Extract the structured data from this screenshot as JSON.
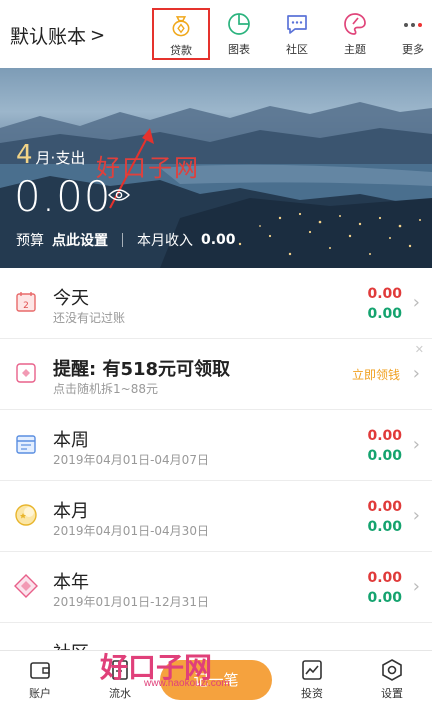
{
  "header": {
    "book_title": "默认账本",
    "chevron": ">",
    "actions": [
      {
        "label": "贷款",
        "icon": "loan-bag-icon"
      },
      {
        "label": "图表",
        "icon": "pie-chart-icon"
      },
      {
        "label": "社区",
        "icon": "chat-bubble-icon"
      },
      {
        "label": "主题",
        "icon": "palette-icon"
      },
      {
        "label": "更多",
        "icon": "more-dots-icon"
      }
    ]
  },
  "banner": {
    "month_num": "4",
    "month_suffix": "月·支出",
    "amount": "0.00",
    "budget_label": "预算",
    "budget_link": "点此设置",
    "income_label": "本月收入",
    "income_value": "0.00",
    "watermark": "好口子网"
  },
  "list": [
    {
      "title": "今天",
      "sub": "还没有记过账",
      "out": "0.00",
      "in": "0.00",
      "icon": "calendar-today-icon"
    },
    {
      "title": "提醒: 有518元可领取",
      "sub": "点击随机拆1~88元",
      "cta": "立即领钱",
      "icon": "red-envelope-icon"
    },
    {
      "title": "本周",
      "sub": "2019年04月01日-04月07日",
      "out": "0.00",
      "in": "0.00",
      "icon": "calendar-week-icon"
    },
    {
      "title": "本月",
      "sub": "2019年04月01日-04月30日",
      "out": "0.00",
      "in": "0.00",
      "icon": "moon-icon"
    },
    {
      "title": "本年",
      "sub": "2019年01月01日-12月31日",
      "out": "0.00",
      "in": "0.00",
      "icon": "diamond-icon"
    },
    {
      "title": "社区",
      "icon": "community-icon"
    }
  ],
  "bottom_nav": {
    "items": [
      {
        "label": "账户",
        "icon": "wallet-icon"
      },
      {
        "label": "流水",
        "icon": "receipt-icon"
      },
      {
        "label": "投资",
        "icon": "trend-chart-icon"
      },
      {
        "label": "设置",
        "icon": "settings-hex-icon"
      }
    ],
    "add_label": "记一笔",
    "watermark_big": "好口子网",
    "watermark_url": "www.haokouzi.com"
  },
  "colors": {
    "expense": "#e03a3a",
    "income": "#14a36f",
    "accent": "#f5a23e",
    "highlight_box": "#e5322d"
  }
}
